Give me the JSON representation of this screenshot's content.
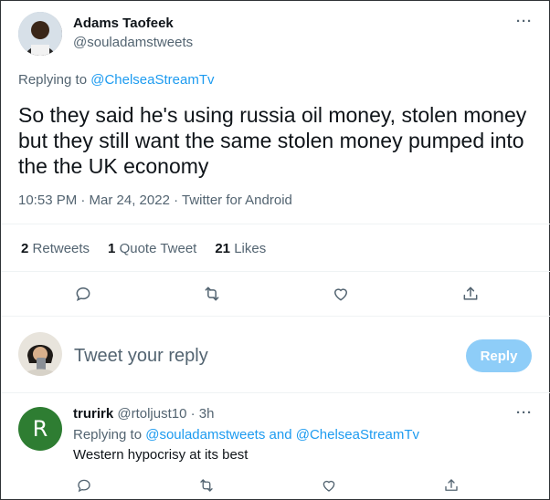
{
  "tweet": {
    "author_name": "Adams Taofeek",
    "author_handle": "@souladamstweets",
    "replying_prefix": "Replying to",
    "replying_to": "@ChelseaStreamTv",
    "text": "So they said he's using russia oil money, stolen money but they still want the same stolen money pumped into the the UK economy",
    "timestamp": "10:53 PM · Mar 24, 2022 · Twitter for Android",
    "retweets_count": "2",
    "retweets_label": "Retweets",
    "quotes_count": "1",
    "quotes_label": "Quote Tweet",
    "likes_count": "21",
    "likes_label": "Likes"
  },
  "compose": {
    "placeholder": "Tweet your reply",
    "button_label": "Reply"
  },
  "reply": {
    "avatar_letter": "R",
    "author_name": "trurirk",
    "author_handle": "@rtoljust10",
    "time": "· 3h",
    "replying_prefix": "Replying to",
    "replying_to_1": "@souladamstweets",
    "replying_and": "and",
    "replying_to_2": "@ChelseaStreamTv",
    "text": "Western hypocrisy at its best"
  },
  "colors": {
    "accent": "#1d9bf0",
    "reply_button_disabled": "#8ecdf8",
    "reply_avatar_bg": "#2e7d32"
  },
  "icons": [
    "more-icon",
    "reply-icon",
    "retweet-icon",
    "like-icon",
    "share-icon"
  ]
}
